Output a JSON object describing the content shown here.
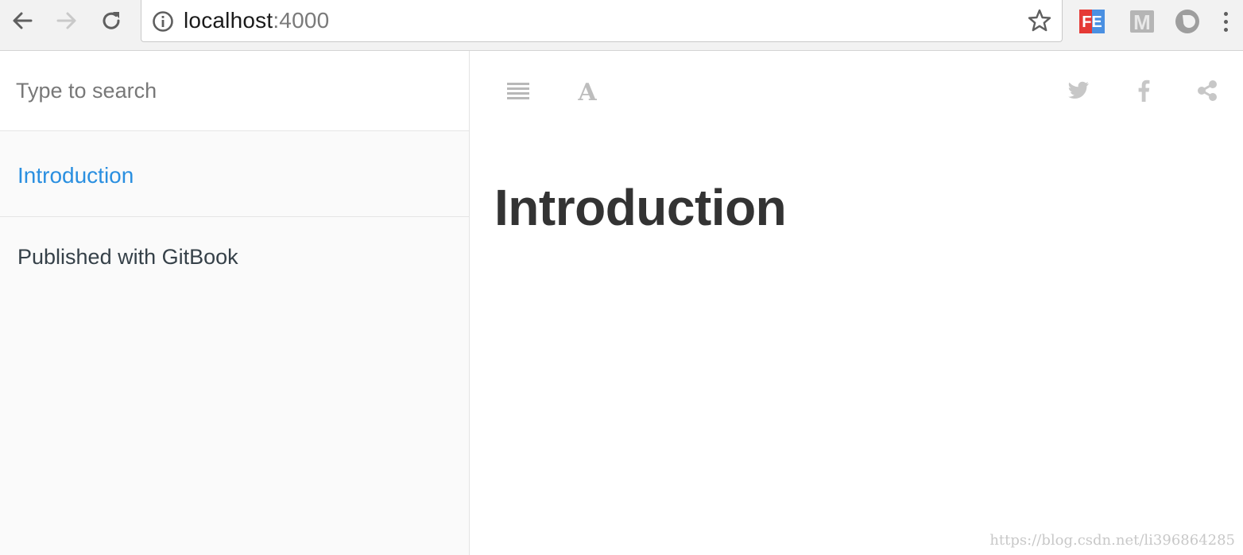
{
  "browser": {
    "url_host": "localhost",
    "url_port": ":4000",
    "extensions": [
      {
        "name": "fe-helper-icon",
        "label": "FE",
        "color": "#e53935"
      },
      {
        "name": "m-extension-icon",
        "label": "M",
        "color": "#9e9e9e"
      },
      {
        "name": "drop-extension-icon",
        "label": "",
        "color": "#9e9e9e"
      }
    ]
  },
  "sidebar": {
    "search_placeholder": "Type to search",
    "summary": [
      {
        "label": "Introduction",
        "active": true
      }
    ],
    "published_label": "Published with GitBook"
  },
  "main": {
    "toolbar_left": [
      "menu-icon",
      "font-settings-icon"
    ],
    "toolbar_right": [
      "twitter-icon",
      "facebook-icon",
      "share-icon"
    ],
    "title": "Introduction",
    "watermark": "https://blog.csdn.net/li396864285"
  },
  "colors": {
    "link_active": "#2a8fe0",
    "text": "#333333",
    "icon_gray": "#c7c7c7"
  }
}
